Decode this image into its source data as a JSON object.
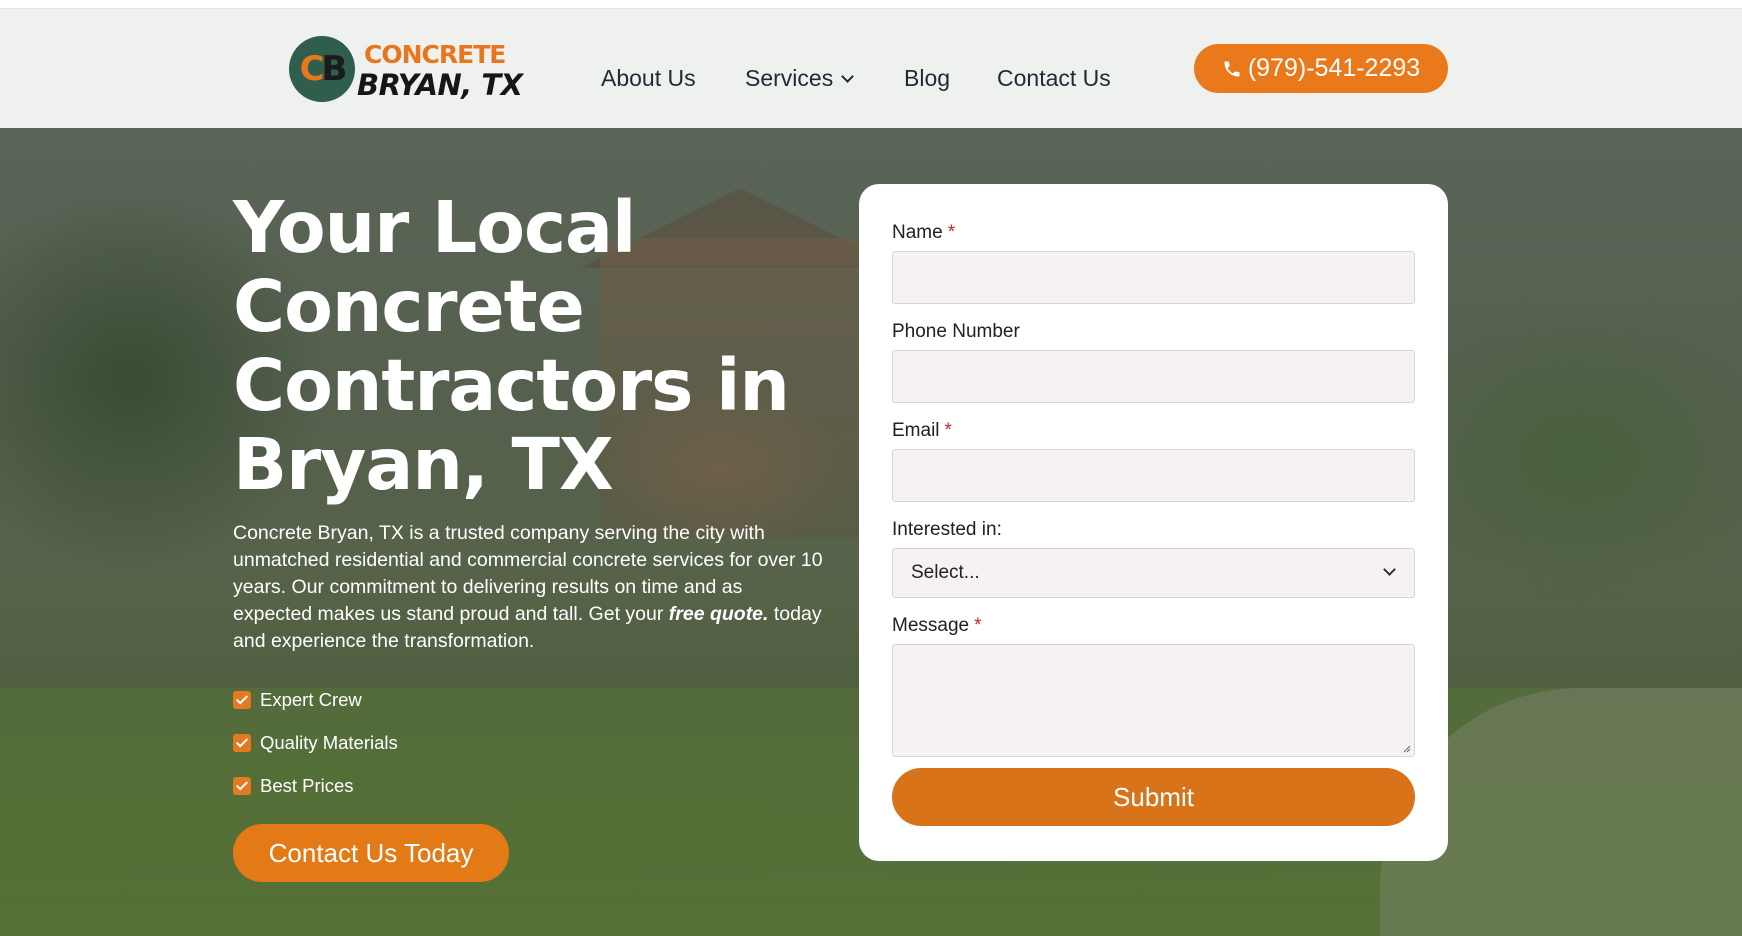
{
  "header": {
    "logo": {
      "monogram_c": "C",
      "monogram_b": "B",
      "line1": "CONCRETE",
      "line2": "BRYAN, TX"
    },
    "nav": [
      {
        "label": "About Us"
      },
      {
        "label": "Services"
      },
      {
        "label": "Blog"
      },
      {
        "label": "Contact Us"
      }
    ],
    "phone": "(979)-541-2293"
  },
  "hero": {
    "title": "Your Local Concrete Contractors in Bryan, TX",
    "description_start": "Concrete Bryan, TX is a trusted company serving the city with unmatched residential and commercial concrete services for over 10 years. Our commitment to delivering results on time and as expected makes us stand proud and tall. Get your ",
    "description_emphasis": "free quote.",
    "description_end": " today and experience the transformation.",
    "features": [
      "Expert Crew",
      "Quality Materials",
      "Best Prices"
    ],
    "cta_label": "Contact Us Today"
  },
  "form": {
    "name_label": "Name",
    "phone_label": "Phone Number",
    "email_label": "Email",
    "interest_label": "Interested in:",
    "interest_selected": "Select...",
    "message_label": "Message",
    "required_mark": "*",
    "submit_label": "Submit"
  },
  "colors": {
    "accent": "#e9791b",
    "brand_green": "#2f5e4d",
    "required": "#c0262d"
  },
  "icons": {
    "phone": "phone-icon",
    "dropdown": "chevron-down-icon",
    "check": "checkbox-checked-icon"
  }
}
